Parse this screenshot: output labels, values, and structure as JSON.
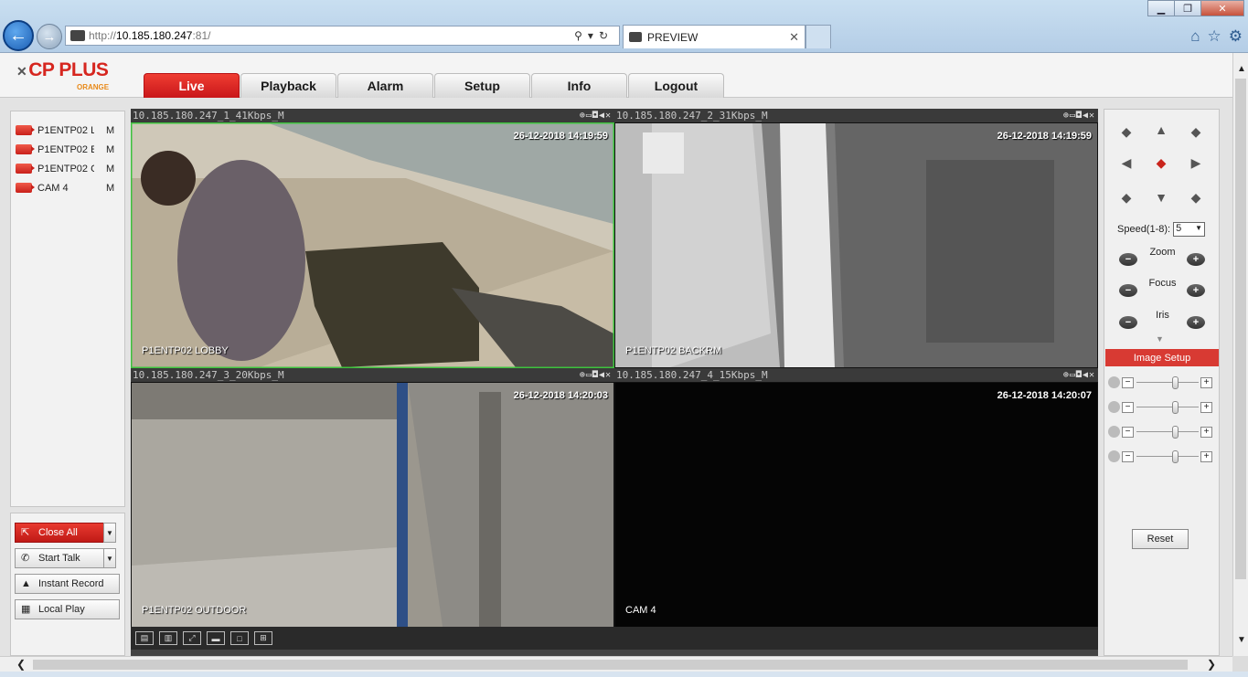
{
  "browser": {
    "url_prefix": "http://",
    "url_host": "10.185.180.247",
    "url_port": ":81/",
    "tab_title": "PREVIEW"
  },
  "logo": {
    "brand": "CP PLUS",
    "sub": "ORANGE"
  },
  "nav": [
    "Live",
    "Playback",
    "Alarm",
    "Setup",
    "Info",
    "Logout"
  ],
  "cameras": [
    {
      "name": "P1ENTP02 L",
      "flag": "M"
    },
    {
      "name": "P1ENTP02 E",
      "flag": "M"
    },
    {
      "name": "P1ENTP02 C",
      "flag": "M"
    },
    {
      "name": "CAM 4",
      "flag": "M"
    }
  ],
  "controls": {
    "close_all": "Close All",
    "start_talk": "Start Talk",
    "instant_record": "Instant Record",
    "local_play": "Local Play"
  },
  "channels": [
    {
      "stream": "10.185.180.247_1_41Kbps_M",
      "timestamp": "26-12-2018 14:19:59",
      "osd": "P1ENTP02 LOBBY"
    },
    {
      "stream": "10.185.180.247_2_31Kbps_M",
      "timestamp": "26-12-2018 14:19:59",
      "osd": "P1ENTP02 BACKRM"
    },
    {
      "stream": "10.185.180.247_3_20Kbps_M",
      "timestamp": "26-12-2018 14:20:03",
      "osd": "P1ENTP02 OUTDOOR"
    },
    {
      "stream": "10.185.180.247_4_15Kbps_M",
      "timestamp": "26-12-2018 14:20:07",
      "osd": "CAM 4"
    }
  ],
  "ptz": {
    "speed_label": "Speed(1-8):",
    "speed_value": "5",
    "zoom": "Zoom",
    "focus": "Focus",
    "iris": "Iris",
    "image_setup": "Image Setup",
    "reset": "Reset",
    "sliders": [
      0.62,
      0.62,
      0.62,
      0.62
    ]
  },
  "colors": {
    "accent": "#d6261f",
    "selected_border": "#3dc23d"
  }
}
